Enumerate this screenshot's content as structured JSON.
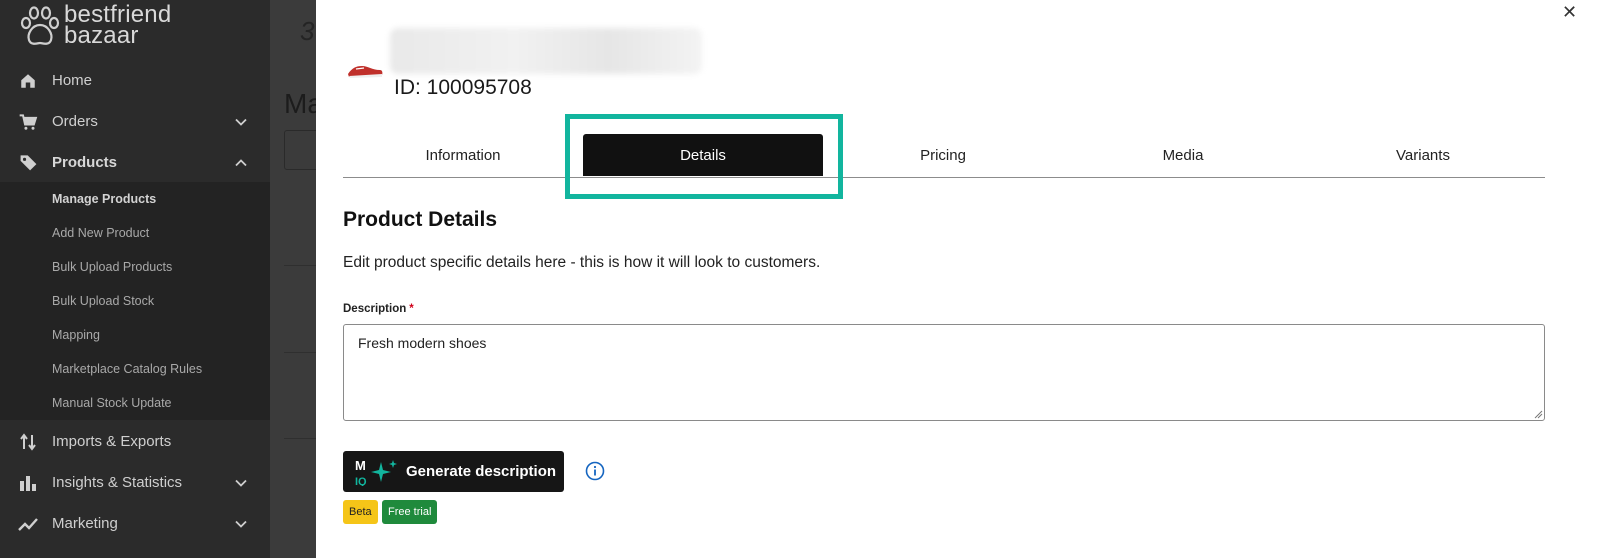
{
  "brand": {
    "line1": "bestfriend",
    "line2": "bazaar"
  },
  "sidebar": {
    "items": [
      {
        "label": "Home",
        "icon": "home-icon"
      },
      {
        "label": "Orders",
        "icon": "cart-icon"
      },
      {
        "label": "Products",
        "icon": "tag-icon"
      },
      {
        "label": "Imports & Exports",
        "icon": "transfer-icon"
      },
      {
        "label": "Insights & Statistics",
        "icon": "bar-chart-icon"
      },
      {
        "label": "Marketing",
        "icon": "trend-icon"
      }
    ],
    "products_sub": [
      "Manage Products",
      "Add New Product",
      "Bulk Upload Products",
      "Bulk Upload Stock",
      "Mapping",
      "Marketplace Catalog Rules",
      "Manual Stock Update"
    ]
  },
  "background": {
    "title_fragment": "Ma"
  },
  "panel": {
    "product_id": "ID: 100095708",
    "tabs": [
      "Information",
      "Details",
      "Pricing",
      "Media",
      "Variants"
    ],
    "active_tab": "Details",
    "section_title": "Product Details",
    "section_desc": "Edit product specific details here - this is how it will look to customers.",
    "description_label": "Description",
    "required_mark": "*",
    "description_value": "Fresh modern shoes",
    "generate_button": "Generate description",
    "badges": {
      "beta": "Beta",
      "trial": "Free trial"
    }
  },
  "colors": {
    "highlight": "#12b59e",
    "sidebar_bg": "#2b2b2b",
    "active_tab_bg": "#111111",
    "beta": "#f5c518",
    "trial": "#1f8a3c"
  }
}
